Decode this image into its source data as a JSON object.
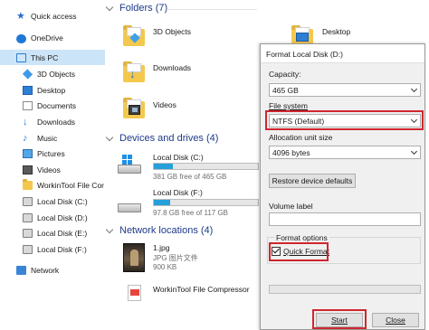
{
  "sidebar": {
    "items": [
      {
        "label": "Quick access",
        "icon": "star-icon"
      },
      {
        "label": "OneDrive",
        "icon": "cloud-icon"
      },
      {
        "label": "This PC",
        "icon": "computer-icon"
      },
      {
        "label": "3D Objects",
        "icon": "cube-icon"
      },
      {
        "label": "Desktop",
        "icon": "desktop-icon"
      },
      {
        "label": "Documents",
        "icon": "document-icon"
      },
      {
        "label": "Downloads",
        "icon": "download-icon"
      },
      {
        "label": "Music",
        "icon": "music-icon"
      },
      {
        "label": "Pictures",
        "icon": "picture-icon"
      },
      {
        "label": "Videos",
        "icon": "video-icon"
      },
      {
        "label": "WorkinTool File Cor",
        "icon": "folder-icon"
      },
      {
        "label": "Local Disk (C:)",
        "icon": "disk-icon"
      },
      {
        "label": "Local Disk (D:)",
        "icon": "disk-icon"
      },
      {
        "label": "Local Disk (E:)",
        "icon": "disk-icon"
      },
      {
        "label": "Local Disk (F:)",
        "icon": "disk-icon"
      },
      {
        "label": "Network",
        "icon": "network-icon"
      }
    ]
  },
  "sections": {
    "folders": "Folders (7)",
    "devices": "Devices and drives (4)",
    "network": "Network locations (4)"
  },
  "folders": [
    {
      "label": "3D Objects"
    },
    {
      "label": "Desktop"
    },
    {
      "label": "Downloads"
    },
    {
      "label": "Videos"
    }
  ],
  "drives": [
    {
      "label": "Local Disk (C:)",
      "info": "381 GB free of 465 GB",
      "used_fraction": 0.18
    },
    {
      "label": "Local Disk (F:)",
      "info": "97.8 GB free of 117 GB",
      "used_fraction": 0.16
    }
  ],
  "files": [
    {
      "label": "1.jpg",
      "meta1": "JPG 图片文件",
      "meta2": "900 KB"
    },
    {
      "label": "WorkinTool File Compressor"
    }
  ],
  "dialog": {
    "title": "Format Local Disk (D:)",
    "capacity_label": "Capacity:",
    "capacity_value": "465 GB",
    "filesystem_label": "File system",
    "filesystem_value": "NTFS (Default)",
    "allocation_label": "Allocation unit size",
    "allocation_value": "4096 bytes",
    "restore_button": "Restore device defaults",
    "volume_label": "Volume label",
    "volume_value": "",
    "format_options_label": "Format options",
    "quick_format_label": "Quick Format",
    "quick_format_checked": true,
    "start_button": "Start",
    "close_button": "Close"
  },
  "colors": {
    "selection": "#cce4f7",
    "accent": "#26a0da",
    "highlight": "#d0262f"
  }
}
